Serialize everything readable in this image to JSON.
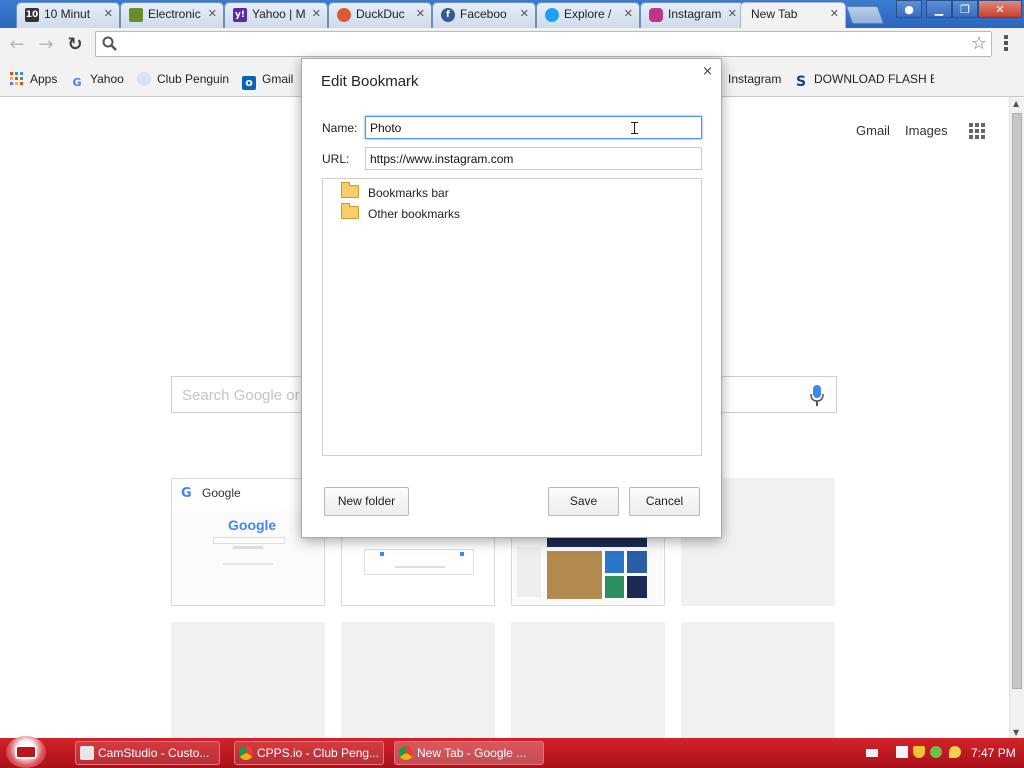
{
  "window": {
    "tabs": [
      {
        "title": "10 Minut",
        "favicon": "tenminute-icon",
        "color": "#333333"
      },
      {
        "title": "Electronic",
        "favicon": "electronics-icon",
        "color": "#6a8f2a"
      },
      {
        "title": "Yahoo | M",
        "favicon": "yahoo-icon",
        "color": "#5c2aa8"
      },
      {
        "title": "DuckDuc",
        "favicon": "duckduckgo-icon",
        "color": "#de5833"
      },
      {
        "title": "Faceboo",
        "favicon": "facebook-icon",
        "color": "#3b5998"
      },
      {
        "title": "Explore /",
        "favicon": "twitter-icon",
        "color": "#1da1f2"
      },
      {
        "title": "Instagram",
        "favicon": "instagram-icon",
        "color": "#c13584"
      }
    ],
    "active_tab": {
      "title": "New Tab"
    },
    "tab_close": "✕"
  },
  "toolbar": {
    "back": "←",
    "forward": "→",
    "reload": "↻",
    "url_value": "",
    "star": "☆"
  },
  "bookmarks": {
    "items": [
      {
        "label": "Apps",
        "icon": "apps-icon"
      },
      {
        "label": "Yahoo",
        "icon": "google-icon"
      },
      {
        "label": "Club Penguin",
        "icon": "clubpenguin-icon"
      },
      {
        "label": "Gmail",
        "icon": "outlook-icon"
      },
      {
        "label": "Instagram",
        "icon": "instagram-icon"
      },
      {
        "label": "DOWNLOAD FLASH B",
        "icon": "download-icon"
      }
    ]
  },
  "ntp": {
    "gmail": "Gmail",
    "images": "Images",
    "search_placeholder": "Search Google or type URL",
    "tiles": [
      {
        "title": "Google"
      }
    ],
    "thumb_google_logo": "Google"
  },
  "dialog": {
    "title": "Edit Bookmark",
    "close": "×",
    "name_label": "Name:",
    "name_value": "Photo",
    "url_label": "URL:",
    "url_value": "https://www.instagram.com",
    "folders": [
      "Bookmarks bar",
      "Other bookmarks"
    ],
    "new_folder": "New folder",
    "save": "Save",
    "cancel": "Cancel"
  },
  "taskbar": {
    "tasks": [
      {
        "label": "CamStudio - Custo...",
        "icon": "camstudio-icon"
      },
      {
        "label": "CPPS.io - Club Peng...",
        "icon": "chrome-icon"
      },
      {
        "label": "New Tab - Google ...",
        "icon": "chrome-icon"
      }
    ],
    "clock": "7:47 PM"
  },
  "colors": {
    "focus_blue": "#4d90fe",
    "taskbar_red": "#c0141c",
    "titlebar_blue": "#2c67bd"
  }
}
